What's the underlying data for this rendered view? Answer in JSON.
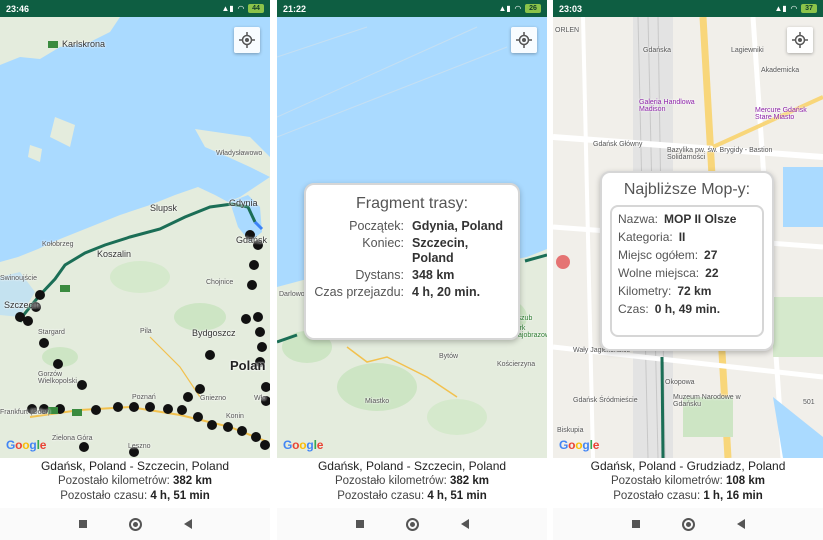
{
  "screens": [
    {
      "status_time": "23:46",
      "battery": "44",
      "map_labels": [
        "Karlskrona",
        "Slupsk",
        "Gdynia",
        "Gdańsk",
        "Władysławowo",
        "Kołobrzeg",
        "Koszalin",
        "Szczecin",
        "Stargard",
        "Pila",
        "Bydgoszcz",
        "Gorzów Wielkopolski",
        "Poznań",
        "Gniezno",
        "Konin",
        "Zielona Góra",
        "Chojnice",
        "Leszno",
        "Frankfurt (Oder)",
        "Polan",
        "Wło",
        "Swinoujście"
      ],
      "route": "Gdańsk, Poland - Szczecin, Poland",
      "km_label": "Pozostało kilometrów:",
      "km_value": "382 km",
      "time_label": "Pozostało czasu:",
      "time_value": "4 h, 51 min"
    },
    {
      "status_time": "21:22",
      "battery": "26",
      "map_labels": [
        "Darlowo",
        "Bytów",
        "Kościerzyna",
        "Miastko",
        "Park Krajobrazowy",
        "Kaszub"
      ],
      "popup": {
        "title": "Fragment trasy:",
        "rows": [
          {
            "k": "Początek:",
            "v": "Gdynia, Poland"
          },
          {
            "k": "Koniec:",
            "v": "Szczecin, Poland"
          },
          {
            "k": "Dystans:",
            "v": "348 km"
          },
          {
            "k": "Czas przejazdu:",
            "v": "4 h, 20 min."
          }
        ]
      },
      "route": "Gdańsk, Poland - Szczecin, Poland",
      "km_label": "Pozostało kilometrów:",
      "km_value": "382 km",
      "time_label": "Pozostało czasu:",
      "time_value": "4 h, 51 min"
    },
    {
      "status_time": "23:03",
      "battery": "37",
      "map_labels": [
        "ORLEN",
        "Galeria Handlowa Madison",
        "Mercure Gdańsk Stare Miasto",
        "Gdańsk Główny",
        "Bazylika pw. św. Brygidy - Bastion Solidarności",
        "Gdańsk Śródmieście",
        "Muzeum Narodowe w Gdańsku",
        "Okopowa",
        "Akademicka",
        "Lagiewniki",
        "Wały Jagiellońskie",
        "Biskupia",
        "Gdańska",
        "501"
      ],
      "popup": {
        "title": "Najbliższe Mop-y:",
        "rows": [
          {
            "k": "Nazwa:",
            "v": "MOP II Olsze"
          },
          {
            "k": "Kategoria:",
            "v": "II"
          },
          {
            "k": "Miejsc ogółem:",
            "v": "27"
          },
          {
            "k": "Wolne miejsca:",
            "v": "22"
          },
          {
            "k": "Kilometry:",
            "v": "72 km"
          },
          {
            "k": "Czas:",
            "v": "0 h, 49 min."
          }
        ]
      },
      "route": "Gdańsk, Poland - Grudziadz, Poland",
      "km_label": "Pozostało kilometrów:",
      "km_value": "108 km",
      "time_label": "Pozostało czasu:",
      "time_value": "1 h, 16 min"
    }
  ],
  "google_logo": "Google",
  "colors": {
    "statusbar": "#0e5e42",
    "route": "#1b6e56",
    "sea": "#aadaff",
    "land": "#e8efe3",
    "city": "#f3f0ea"
  },
  "icons": [
    "my-location-icon",
    "parking-marker-icon",
    "home-nav-icon",
    "back-nav-icon",
    "recents-nav-icon"
  ]
}
